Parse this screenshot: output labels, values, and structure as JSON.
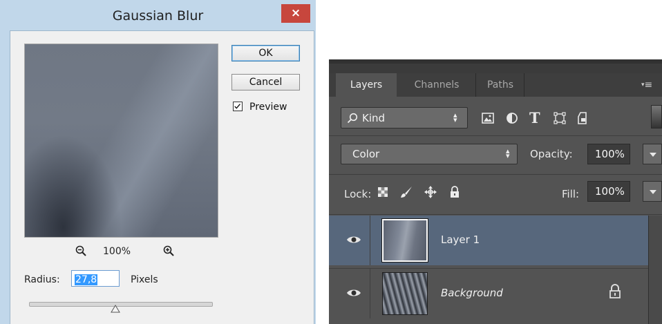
{
  "dialog": {
    "title": "Gaussian Blur",
    "close_label": "×",
    "zoom_level": "100%",
    "radius_label": "Radius:",
    "radius_value": "27,8",
    "units_label": "Pixels",
    "ok_label": "OK",
    "cancel_label": "Cancel",
    "preview_label": "Preview",
    "preview_checked": true,
    "slider_fraction": 0.47,
    "icons": [
      "zoom-out-icon",
      "zoom-in-icon",
      "slider-thumb-icon"
    ]
  },
  "panel": {
    "tabs": [
      {
        "label": "Layers",
        "active": true
      },
      {
        "label": "Channels",
        "active": false
      },
      {
        "label": "Paths",
        "active": false
      }
    ],
    "menu_icon": "≡",
    "filter": {
      "kind_label": "Kind",
      "icons": [
        "image-filter-icon",
        "adjustment-filter-icon",
        "type-filter-icon",
        "shape-filter-icon",
        "smart-object-filter-icon"
      ],
      "type_glyph": "T"
    },
    "blend_mode": "Color",
    "opacity_label": "Opacity:",
    "opacity_value": "100%",
    "lock_label": "Lock:",
    "lock_icons": [
      "lock-transparent-pixels-icon",
      "lock-image-pixels-icon",
      "lock-position-icon",
      "lock-all-icon"
    ],
    "fill_label": "Fill:",
    "fill_value": "100%",
    "layers": [
      {
        "name": "Layer 1",
        "visible": true,
        "selected": true,
        "italic": false,
        "locked": false
      },
      {
        "name": "Background",
        "visible": true,
        "selected": false,
        "italic": true,
        "locked": true
      }
    ]
  },
  "colors": {
    "dialog_frame": "#c1d7ea",
    "close_button": "#c7463d",
    "panel_bg": "#535353",
    "selected_layer": "#57677c",
    "selection_highlight": "#3399ff"
  }
}
